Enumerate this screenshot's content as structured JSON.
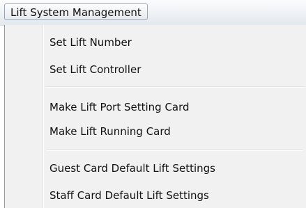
{
  "menubar": {
    "title": "Lift System Management"
  },
  "menu": {
    "items": [
      {
        "label": "Set Lift Number"
      },
      {
        "label": "Set Lift Controller"
      },
      {
        "label": "Make Lift Port Setting Card"
      },
      {
        "label": "Make Lift Running Card"
      },
      {
        "label": "Guest Card Default Lift Settings"
      },
      {
        "label": "Staff Card Default Lift Settings"
      }
    ]
  }
}
